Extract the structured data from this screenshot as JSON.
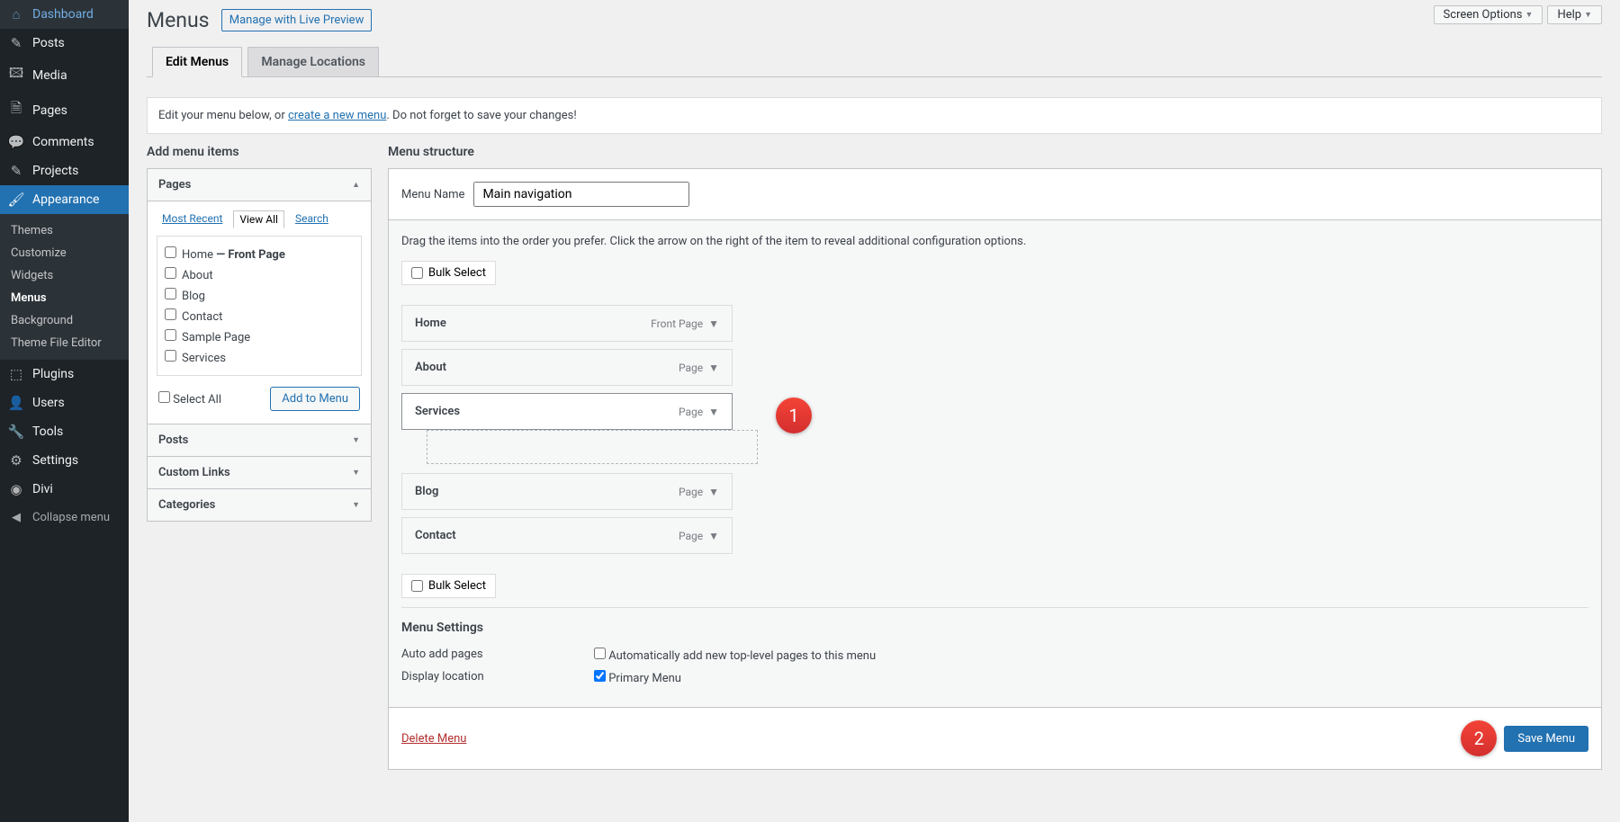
{
  "top_right": {
    "screen_options": "Screen Options",
    "help": "Help"
  },
  "header": {
    "title": "Menus",
    "live_preview": "Manage with Live Preview"
  },
  "tabs": [
    "Edit Menus",
    "Manage Locations"
  ],
  "notice": {
    "pre": "Edit your menu below, or ",
    "link": "create a new menu",
    "post": ". Do not forget to save your changes!"
  },
  "sidebar": {
    "items": [
      {
        "icon": "⌂",
        "label": "Dashboard"
      },
      {
        "icon": "✎",
        "label": "Posts"
      },
      {
        "icon": "🖾",
        "label": "Media"
      },
      {
        "icon": "🗎",
        "label": "Pages"
      },
      {
        "icon": "💬",
        "label": "Comments"
      },
      {
        "icon": "✎",
        "label": "Projects"
      },
      {
        "icon": "🖌",
        "label": "Appearance",
        "active": true
      },
      {
        "icon": "⬚",
        "label": "Plugins"
      },
      {
        "icon": "👤",
        "label": "Users"
      },
      {
        "icon": "🔧",
        "label": "Tools"
      },
      {
        "icon": "⚙",
        "label": "Settings"
      },
      {
        "icon": "◉",
        "label": "Divi"
      }
    ],
    "submenu": [
      "Themes",
      "Customize",
      "Widgets",
      "Menus",
      "Background",
      "Theme File Editor"
    ],
    "collapse": "Collapse menu"
  },
  "add_panel": {
    "title": "Add menu items",
    "pages_box": {
      "title": "Pages",
      "tabs": [
        "Most Recent",
        "View All",
        "Search"
      ],
      "items": [
        {
          "text": "Home",
          "suffix": " — Front Page"
        },
        {
          "text": "About"
        },
        {
          "text": "Blog"
        },
        {
          "text": "Contact"
        },
        {
          "text": "Sample Page"
        },
        {
          "text": "Services"
        }
      ],
      "select_all": "Select All",
      "add_btn": "Add to Menu"
    },
    "collapsed": [
      "Posts",
      "Custom Links",
      "Categories"
    ]
  },
  "structure": {
    "title": "Menu structure",
    "name_label": "Menu Name",
    "name_value": "Main navigation",
    "instructions": "Drag the items into the order you prefer. Click the arrow on the right of the item to reveal additional configuration options.",
    "bulk_select": "Bulk Select",
    "items": [
      {
        "label": "Home",
        "type": "Front Page"
      },
      {
        "label": "About",
        "type": "Page"
      },
      {
        "label": "Services",
        "type": "Page",
        "drag": true
      },
      {
        "label": "Blog",
        "type": "Page"
      },
      {
        "label": "Contact",
        "type": "Page"
      }
    ],
    "annotations": {
      "one": "1",
      "two": "2"
    },
    "settings": {
      "title": "Menu Settings",
      "auto_add_label": "Auto add pages",
      "auto_add_check": "Automatically add new top-level pages to this menu",
      "display_label": "Display location",
      "primary": "Primary Menu"
    },
    "footer": {
      "delete": "Delete Menu",
      "save": "Save Menu"
    }
  }
}
